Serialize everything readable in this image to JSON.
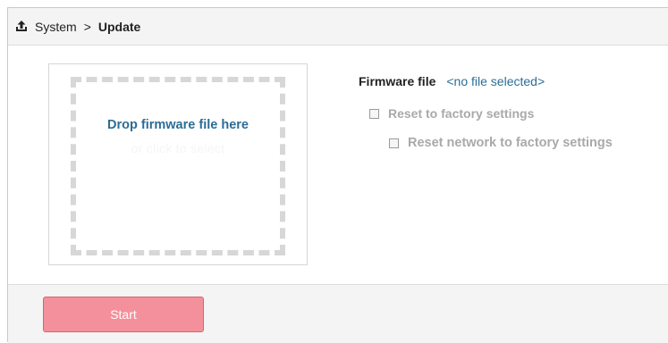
{
  "breadcrumb": {
    "icon": "upload-icon",
    "parent": "System",
    "separator": ">",
    "current": "Update"
  },
  "dropzone": {
    "title": "Drop firmware file here",
    "subtitle": "or click to select"
  },
  "firmware": {
    "label": "Firmware file",
    "value": "<no file selected>"
  },
  "options": {
    "reset_factory": {
      "label": "Reset to factory settings",
      "checked": false,
      "disabled": true
    },
    "reset_network": {
      "label": "Reset network to factory settings",
      "checked": false,
      "disabled": true
    }
  },
  "footer": {
    "start_label": "Start"
  },
  "colors": {
    "accent_link": "#2c6d95",
    "start_button": "#f4909b",
    "disabled_text": "#a9a9a9"
  }
}
